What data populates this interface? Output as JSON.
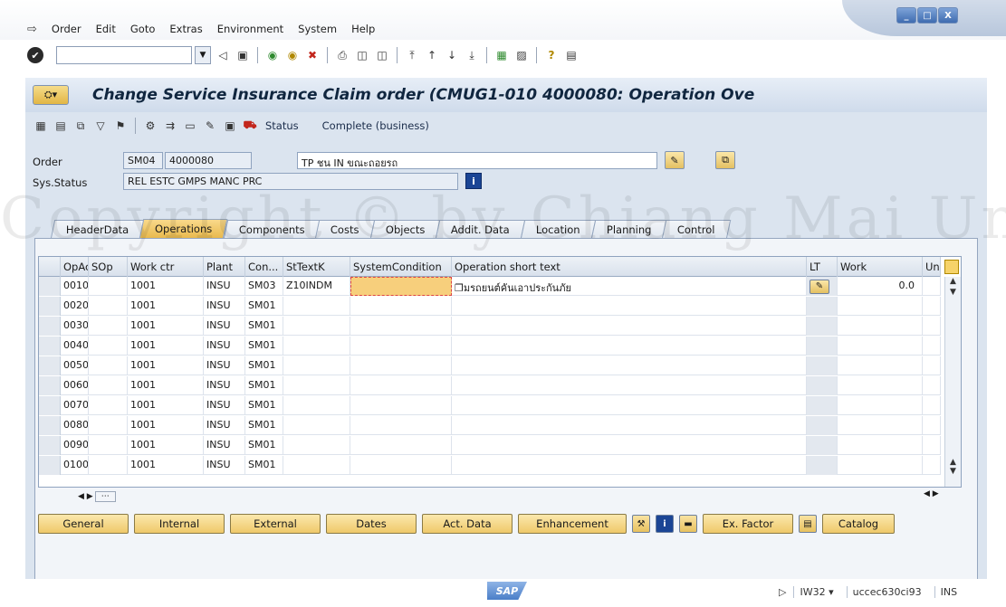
{
  "menu": {
    "items": [
      "Order",
      "Edit",
      "Goto",
      "Extras",
      "Environment",
      "System",
      "Help"
    ]
  },
  "window": {
    "minimize": "_",
    "restore": "□",
    "close": "X"
  },
  "transaction": {
    "title": "Change Service Insurance Claim order (CMUG1-010 4000080: Operation Ove"
  },
  "app_toolbar": {
    "status_button": "Status",
    "complete_button": "Complete (business)"
  },
  "header": {
    "order_label": "Order",
    "order_type": "SM04",
    "order_number": "4000080",
    "order_description": "TP ชน IN ขณะถอยรถ",
    "sys_status_label": "Sys.Status",
    "sys_status_value": "REL  ESTC GMPS MANC PRC"
  },
  "tabs": [
    "HeaderData",
    "Operations",
    "Components",
    "Costs",
    "Objects",
    "Addit. Data",
    "Location",
    "Planning",
    "Control"
  ],
  "active_tab": "Operations",
  "table": {
    "columns": [
      "OpAc",
      "SOp",
      "Work ctr",
      "Plant",
      "Con...",
      "StTextK",
      "SystemCondition",
      "Operation short text",
      "LT",
      "Work",
      "Un"
    ],
    "rows": [
      {
        "opac": "0010",
        "sop": "",
        "work_ctr": "1001",
        "plant": "INSU",
        "con": "SM03",
        "sttextk": "Z10INDM",
        "syscond": "",
        "text": "มรถยนต์คันเอาประกันภัย",
        "work": "0.0"
      },
      {
        "opac": "0020",
        "sop": "",
        "work_ctr": "1001",
        "plant": "INSU",
        "con": "SM01",
        "sttextk": "",
        "syscond": "",
        "text": "",
        "work": ""
      },
      {
        "opac": "0030",
        "sop": "",
        "work_ctr": "1001",
        "plant": "INSU",
        "con": "SM01",
        "sttextk": "",
        "syscond": "",
        "text": "",
        "work": ""
      },
      {
        "opac": "0040",
        "sop": "",
        "work_ctr": "1001",
        "plant": "INSU",
        "con": "SM01",
        "sttextk": "",
        "syscond": "",
        "text": "",
        "work": ""
      },
      {
        "opac": "0050",
        "sop": "",
        "work_ctr": "1001",
        "plant": "INSU",
        "con": "SM01",
        "sttextk": "",
        "syscond": "",
        "text": "",
        "work": ""
      },
      {
        "opac": "0060",
        "sop": "",
        "work_ctr": "1001",
        "plant": "INSU",
        "con": "SM01",
        "sttextk": "",
        "syscond": "",
        "text": "",
        "work": ""
      },
      {
        "opac": "0070",
        "sop": "",
        "work_ctr": "1001",
        "plant": "INSU",
        "con": "SM01",
        "sttextk": "",
        "syscond": "",
        "text": "",
        "work": ""
      },
      {
        "opac": "0080",
        "sop": "",
        "work_ctr": "1001",
        "plant": "INSU",
        "con": "SM01",
        "sttextk": "",
        "syscond": "",
        "text": "",
        "work": ""
      },
      {
        "opac": "0090",
        "sop": "",
        "work_ctr": "1001",
        "plant": "INSU",
        "con": "SM01",
        "sttextk": "",
        "syscond": "",
        "text": "",
        "work": ""
      },
      {
        "opac": "0100",
        "sop": "",
        "work_ctr": "1001",
        "plant": "INSU",
        "con": "SM01",
        "sttextk": "",
        "syscond": "",
        "text": "",
        "work": ""
      }
    ]
  },
  "buttons": {
    "general": "General",
    "internal": "Internal",
    "external": "External",
    "dates": "Dates",
    "act_data": "Act. Data",
    "enhancement": "Enhancement",
    "ex_factor": "Ex. Factor",
    "catalog": "Catalog"
  },
  "status_bar": {
    "sap_logo": "SAP",
    "transaction_code": "IW32",
    "server": "uccec630ci93",
    "mode": "INS"
  },
  "watermark": {
    "text": "Copyright © by Chiang Mai University  rights reserved"
  },
  "colors": {
    "accent": "#e8b84b",
    "panel": "#dbe4ef",
    "field": "#e7edf5"
  }
}
